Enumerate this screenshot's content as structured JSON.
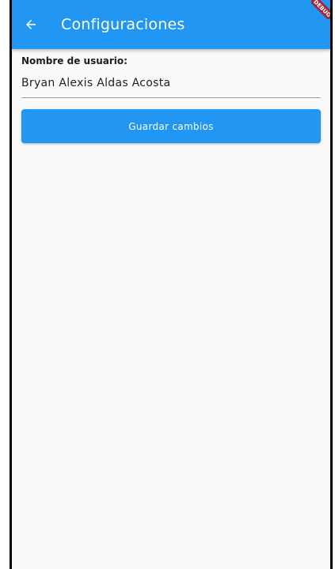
{
  "app_bar": {
    "title": "Configuraciones",
    "back_icon": "arrow-left-icon",
    "background_color": "#2196f3",
    "banner_color": "#a3283e"
  },
  "form": {
    "username_label": "Nombre de usuario:",
    "username_value": "Bryan Alexis Aldas Acosta",
    "save_button_label": "Guardar cambios",
    "save_button_color": "#2196f3"
  }
}
